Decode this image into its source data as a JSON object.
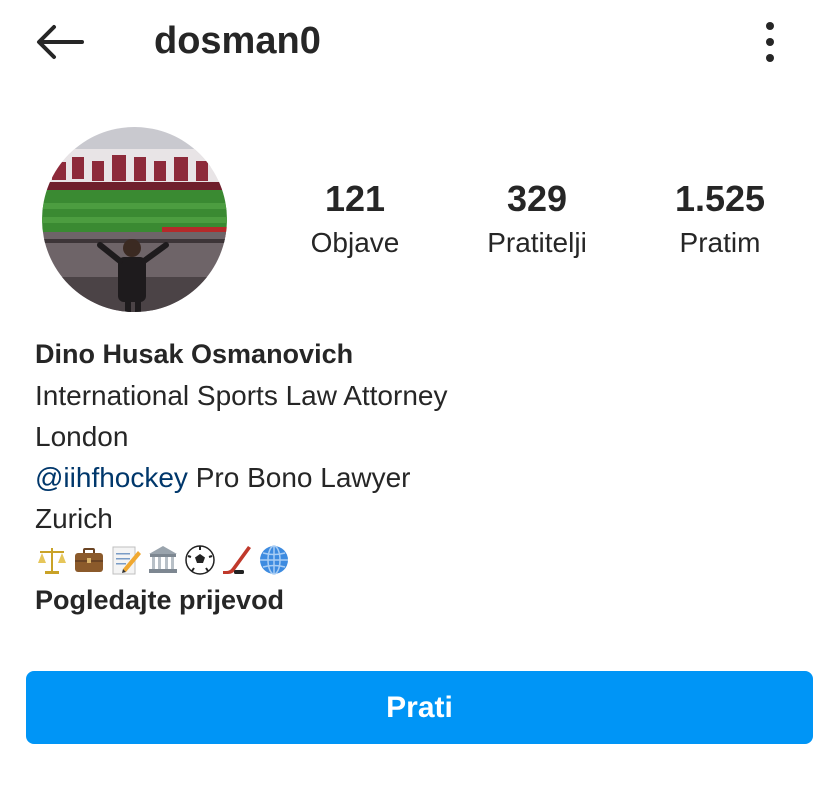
{
  "header": {
    "username": "dosman0"
  },
  "stats": {
    "posts": {
      "value": "121",
      "label": "Objave"
    },
    "followers": {
      "value": "329",
      "label": "Pratitelji"
    },
    "following": {
      "value": "1.525",
      "label": "Pratim"
    }
  },
  "bio": {
    "full_name": "Dino Husak Osmanovich",
    "line1": "International Sports Law Attorney",
    "line2": "London",
    "mention": "@iihfhockey",
    "line3_rest": " Pro Bono Lawyer",
    "line4": "Zurich",
    "emojis": [
      "scales-icon",
      "briefcase-icon",
      "memo-icon",
      "bank-icon",
      "soccer-ball-icon",
      "hockey-stick-icon",
      "globe-icon"
    ],
    "translate_link": "Pogledajte prijevod"
  },
  "actions": {
    "follow_label": "Prati"
  },
  "colors": {
    "accent": "#0095f6",
    "mention": "#00376b",
    "text": "#262626"
  }
}
